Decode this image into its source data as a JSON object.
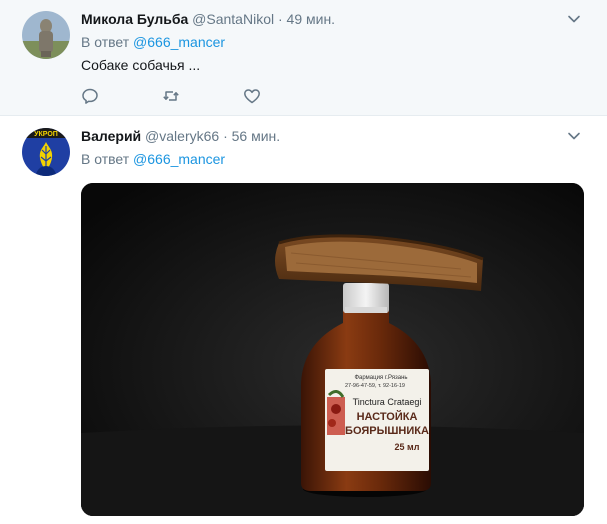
{
  "tweets": [
    {
      "name": "Микола Бульба",
      "handle": "@SantaNikol",
      "separator": "·",
      "time": "49 мин.",
      "reply_prefix": "В ответ",
      "reply_mention": "@666_mancer",
      "text": "Собаке собачья ..."
    },
    {
      "name": "Валерий",
      "handle": "@valeryk66",
      "separator": "·",
      "time": "56 мин.",
      "reply_prefix": "В ответ",
      "reply_mention": "@666_mancer",
      "avatar_text": "УКРОП",
      "photo": {
        "label_lines": [
          "Tinctura Crataegi",
          "НАСТОЙКА",
          "БОЯРЫШНИКА",
          "25 мл"
        ],
        "label_top": "Фармация г.Рязань",
        "label_phone": "27-96-47-59, т. 92-16-19"
      }
    }
  ],
  "colors": {
    "accent": "#1b95e0",
    "muted": "#657786",
    "text": "#14171a",
    "hover_bg": "#f5f8fa",
    "border": "#e6ecf0"
  },
  "icons": [
    "reply-icon",
    "retweet-icon",
    "like-icon",
    "chevron-down-icon"
  ]
}
